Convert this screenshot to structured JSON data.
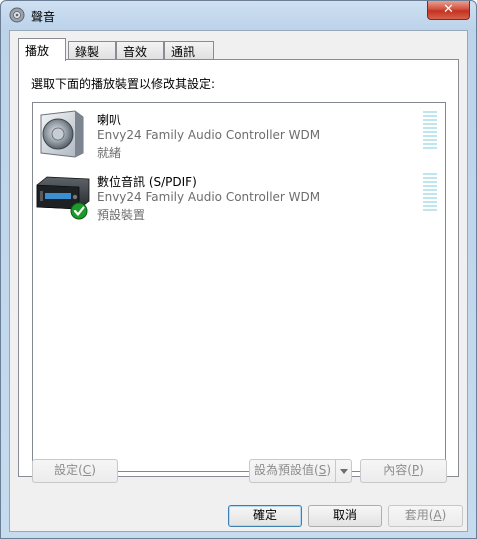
{
  "window": {
    "title": "聲音",
    "close_label": "✕"
  },
  "tabs": [
    {
      "label": "播放"
    },
    {
      "label": "錄製"
    },
    {
      "label": "音效"
    },
    {
      "label": "通訊"
    }
  ],
  "instruction": "選取下面的播放裝置以修改其設定:",
  "devices": [
    {
      "name": "喇叭",
      "description": "Envy24 Family Audio Controller WDM",
      "status": "就緒",
      "icon": "speaker-icon",
      "is_default": false,
      "level": 0
    },
    {
      "name": "數位音訊 (S/PDIF)",
      "description": "Envy24 Family Audio Controller WDM",
      "status": "預設裝置",
      "icon": "digital-receiver-icon",
      "is_default": true,
      "level": 0
    }
  ],
  "panel_buttons": {
    "configure": {
      "text": "設定(",
      "key": "C",
      "end": ")"
    },
    "set_default": {
      "text": "設為預設值(",
      "key": "S",
      "end": ")"
    },
    "properties": {
      "text": "內容(",
      "key": "P",
      "end": ")"
    }
  },
  "dialog_buttons": {
    "ok": "確定",
    "cancel": "取消",
    "apply": {
      "text": "套用(",
      "key": "A",
      "end": ")"
    }
  },
  "colors": {
    "title_gradient": "#bcd3ea",
    "close_red": "#c2321f",
    "meter": "#bfe6ee",
    "secondary_text": "#6d6d6d"
  }
}
